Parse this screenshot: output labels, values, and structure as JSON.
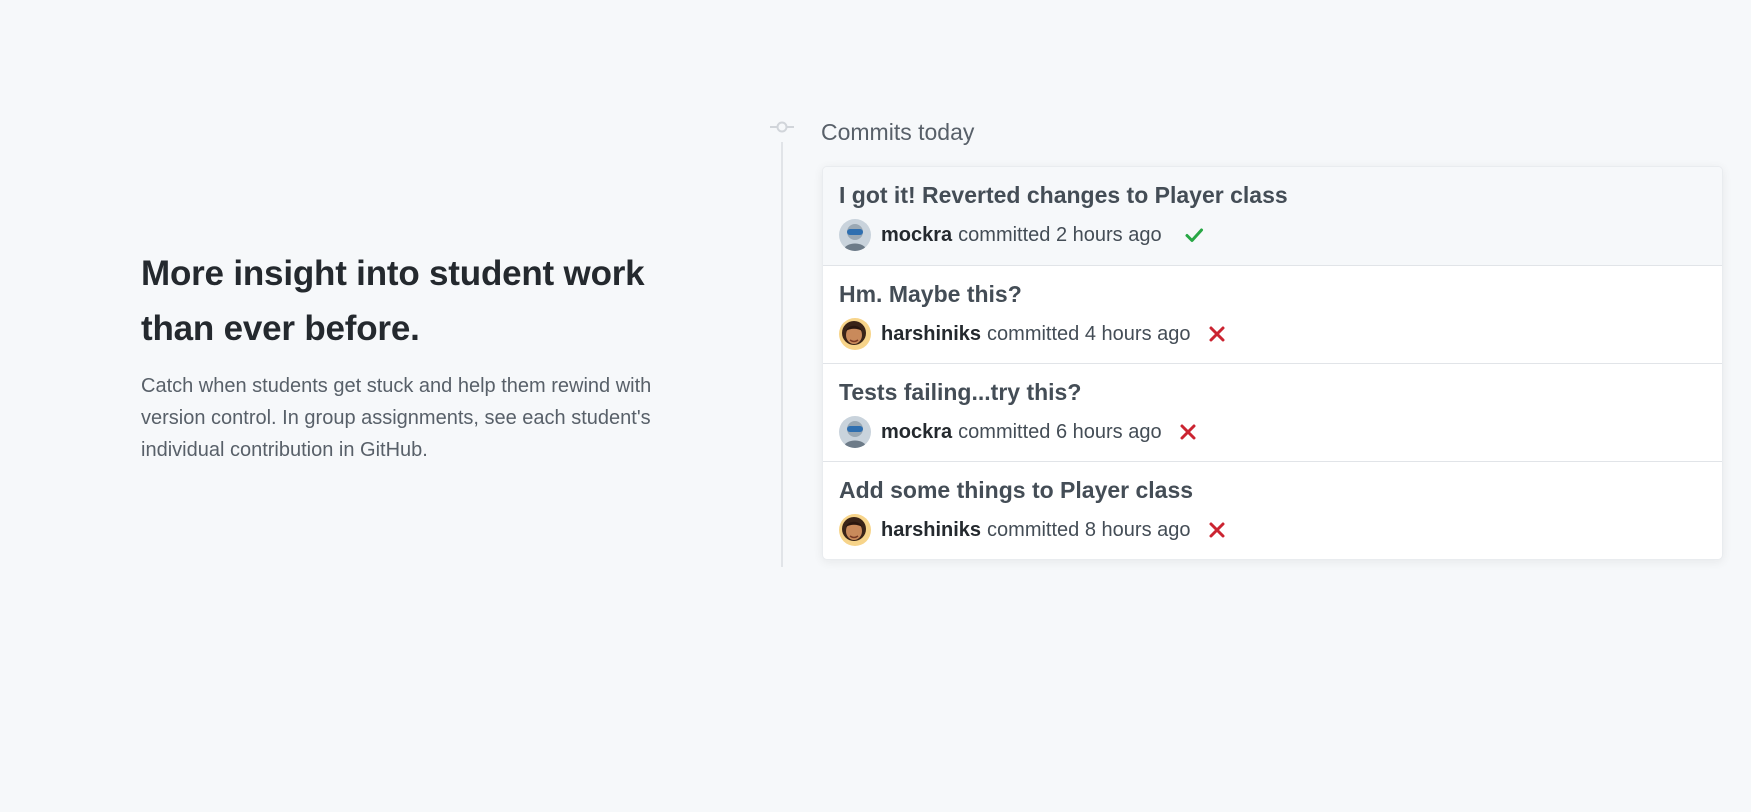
{
  "intro": {
    "heading": "More insight into student work than ever before.",
    "description": "Catch when students get stuck and help them rewind with version control. In group assignments, see each student's individual contribution in GitHub."
  },
  "timeline": {
    "title": "Commits today",
    "icon": "git-commit-icon"
  },
  "commits": [
    {
      "message": "I got it! Reverted changes to Player class",
      "author": "mockra",
      "action": "committed",
      "time": "2 hours ago",
      "status": "success",
      "status_icon": "check-icon"
    },
    {
      "message": "Hm. Maybe this?",
      "author": "harshiniks",
      "action": "committed",
      "time": "4 hours ago",
      "status": "failure",
      "status_icon": "x-icon"
    },
    {
      "message": "Tests failing...try this?",
      "author": "mockra",
      "action": "committed",
      "time": "6 hours ago",
      "status": "failure",
      "status_icon": "x-icon"
    },
    {
      "message": "Add some things to Player class",
      "author": "harshiniks",
      "action": "committed",
      "time": "8 hours ago",
      "status": "failure",
      "status_icon": "x-icon"
    }
  ],
  "colors": {
    "success": "#28a745",
    "failure": "#cb2431",
    "background": "#f6f8fa"
  }
}
